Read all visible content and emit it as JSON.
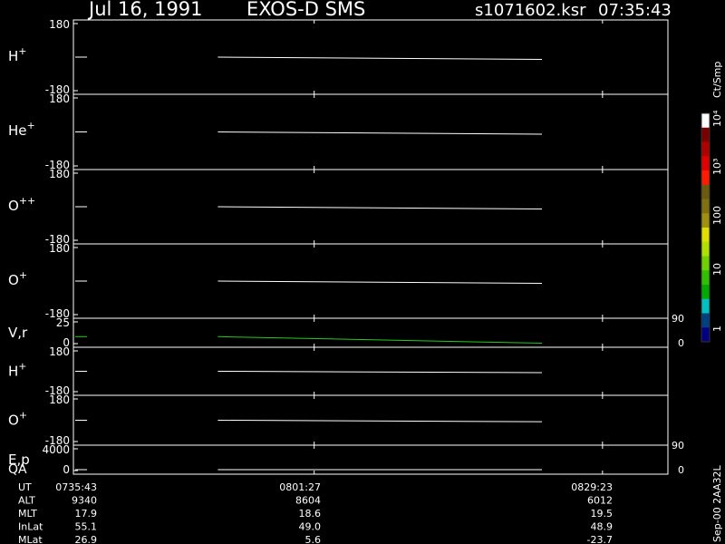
{
  "header": {
    "date": "Jul 16, 1991",
    "instrument": "EXOS-D SMS",
    "file": "s1071602.ksr",
    "time": "07:35:43"
  },
  "colors": {
    "background": "#000000",
    "foreground": "#ffffff",
    "trace": "#ffffff",
    "velocity_trace": "#22cc22"
  },
  "colorbar": {
    "unit": "Ct/Smp",
    "labels": [
      "10⁴",
      "10³",
      "100",
      "10",
      "1"
    ],
    "colors": [
      "#ffffff",
      "#7a0000",
      "#b00000",
      "#e00000",
      "#ff1a00",
      "#6b5a10",
      "#807010",
      "#a09010",
      "#e0e000",
      "#b0e000",
      "#70d000",
      "#30c000",
      "#00aa00",
      "#00c0c0",
      "#004080",
      "#000080"
    ]
  },
  "footer": {
    "stamp": "Sep-00 2AA32L"
  },
  "chart_data": {
    "type": "line",
    "x_ticks": [
      "0735:43",
      "0801:27",
      "0829:23"
    ],
    "panels": [
      {
        "id": "h-plus-1",
        "label_base": "H",
        "label_sup": "+",
        "ymax": "180",
        "ymin": "-180",
        "yrange": [
          -180,
          180
        ],
        "segments": [
          [
            [
              0.0,
              0.0
            ],
            [
              0.02,
              0.0
            ]
          ],
          [
            [
              0.24,
              0.0
            ],
            [
              0.785,
              -12.0
            ]
          ]
        ]
      },
      {
        "id": "he-plus",
        "label_base": "He",
        "label_sup": "+",
        "ymax": "180",
        "ymin": "-180",
        "yrange": [
          -180,
          180
        ],
        "segments": [
          [
            [
              0.0,
              0.0
            ],
            [
              0.02,
              0.0
            ]
          ],
          [
            [
              0.24,
              0.0
            ],
            [
              0.785,
              -12.0
            ]
          ]
        ]
      },
      {
        "id": "o-plusplus",
        "label_base": "O",
        "label_sup": "++",
        "ymax": "180",
        "ymin": "-180",
        "yrange": [
          -180,
          180
        ],
        "segments": [
          [
            [
              0.0,
              0.0
            ],
            [
              0.02,
              0.0
            ]
          ],
          [
            [
              0.24,
              0.0
            ],
            [
              0.785,
              -12.0
            ]
          ]
        ]
      },
      {
        "id": "o-plus-1",
        "label_base": "O",
        "label_sup": "+",
        "ymax": "180",
        "ymin": "-180",
        "yrange": [
          -180,
          180
        ],
        "segments": [
          [
            [
              0.0,
              0.0
            ],
            [
              0.02,
              0.0
            ]
          ],
          [
            [
              0.24,
              0.0
            ],
            [
              0.785,
              -12.0
            ]
          ]
        ]
      },
      {
        "id": "v-r",
        "label_base": "V,r",
        "label_sup": "",
        "ymax": "25",
        "ymin": "0",
        "yrange": [
          0,
          25
        ],
        "right_top": "90",
        "right_bottom": "0",
        "trace_color": "#22cc22",
        "segments": [
          [
            [
              0.0,
              8.0
            ],
            [
              0.02,
              8.0
            ]
          ],
          [
            [
              0.24,
              8.0
            ],
            [
              0.785,
              0.5
            ]
          ]
        ]
      },
      {
        "id": "h-plus-2",
        "label_base": "H",
        "label_sup": "+",
        "ymax": "180",
        "ymin": "-180",
        "yrange": [
          -180,
          180
        ],
        "segments": [
          [
            [
              0.0,
              0.0
            ],
            [
              0.02,
              0.0
            ]
          ],
          [
            [
              0.24,
              0.0
            ],
            [
              0.785,
              -12.0
            ]
          ]
        ]
      },
      {
        "id": "o-plus-2",
        "label_base": "O",
        "label_sup": "+",
        "ymax": "180",
        "ymin": "-180",
        "yrange": [
          -180,
          180
        ],
        "segments": [
          [
            [
              0.0,
              0.0
            ],
            [
              0.02,
              0.0
            ]
          ],
          [
            [
              0.24,
              0.0
            ],
            [
              0.785,
              -12.0
            ]
          ]
        ]
      },
      {
        "id": "e-p-qa",
        "label_base": "E,p",
        "label_sup": "",
        "label2": "QA",
        "ymax": "4000",
        "ymin": "0",
        "yrange": [
          0,
          4000
        ],
        "right_top": "90",
        "right_bottom": "0",
        "segments": [
          [
            [
              0.0,
              0.0
            ],
            [
              0.02,
              0.0
            ]
          ],
          [
            [
              0.24,
              0.0
            ],
            [
              0.785,
              0.0
            ]
          ]
        ]
      }
    ],
    "ephemeris": {
      "labels": [
        "UT",
        "ALT",
        "MLT",
        "InLat",
        "MLat"
      ],
      "rows": [
        [
          "0735:43",
          "0801:27",
          "0829:23"
        ],
        [
          "9340",
          "8604",
          "6012"
        ],
        [
          "17.9",
          "18.6",
          "19.5"
        ],
        [
          "55.1",
          "49.0",
          "48.9"
        ],
        [
          "26.9",
          "5.6",
          "-23.7"
        ]
      ]
    }
  }
}
